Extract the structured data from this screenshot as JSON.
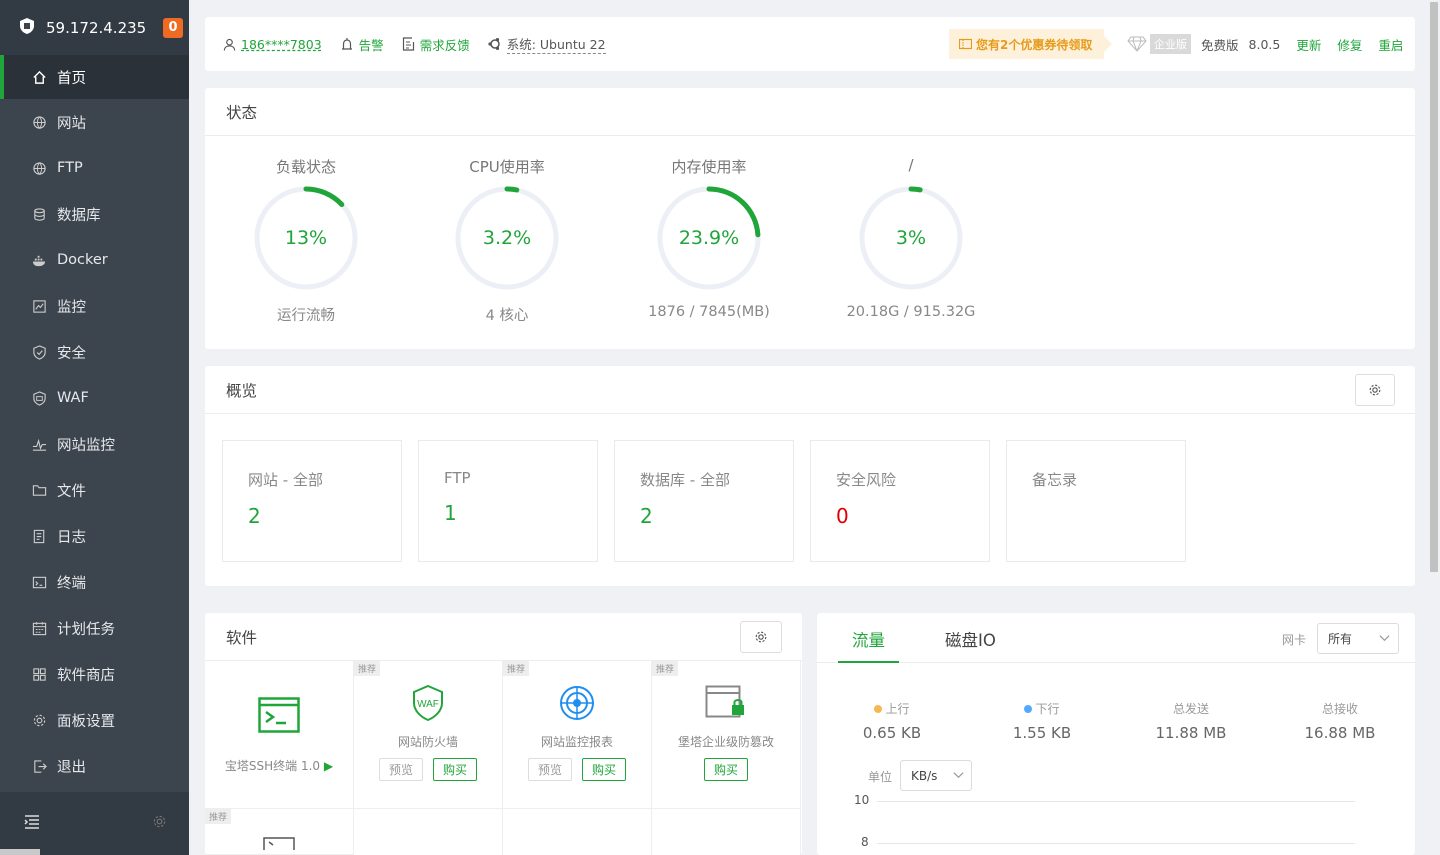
{
  "sidebar": {
    "server_ip": "59.172.4.235",
    "badge_count": "0",
    "items": [
      {
        "label": "首页",
        "icon": "home-icon"
      },
      {
        "label": "网站",
        "icon": "globe-icon"
      },
      {
        "label": "FTP",
        "icon": "globe-icon"
      },
      {
        "label": "数据库",
        "icon": "database-icon"
      },
      {
        "label": "Docker",
        "icon": "docker-icon"
      },
      {
        "label": "监控",
        "icon": "monitor-icon"
      },
      {
        "label": "安全",
        "icon": "shield-icon"
      },
      {
        "label": "WAF",
        "icon": "waf-icon"
      },
      {
        "label": "网站监控",
        "icon": "pulse-icon"
      },
      {
        "label": "文件",
        "icon": "folder-icon"
      },
      {
        "label": "日志",
        "icon": "log-icon"
      },
      {
        "label": "终端",
        "icon": "terminal-icon"
      },
      {
        "label": "计划任务",
        "icon": "calendar-icon"
      },
      {
        "label": "软件商店",
        "icon": "grid-icon"
      },
      {
        "label": "面板设置",
        "icon": "gear-icon"
      },
      {
        "label": "退出",
        "icon": "logout-icon"
      }
    ]
  },
  "topbar": {
    "user": "186****7803",
    "alarm": "告警",
    "feedback": "需求反馈",
    "system": "系统:  Ubuntu 22",
    "coupon": "您有2个优惠券待领取",
    "enterprise_tag": "企业版",
    "edition": "免费版",
    "version": "8.0.5",
    "update": "更新",
    "repair": "修复",
    "restart": "重启"
  },
  "status": {
    "title": "状态",
    "gauges": [
      {
        "label": "负载状态",
        "value": "13%",
        "pct": 13,
        "sub": "运行流畅"
      },
      {
        "label": "CPU使用率",
        "value": "3.2%",
        "pct": 3.2,
        "sub": "4 核心"
      },
      {
        "label": "内存使用率",
        "value": "23.9%",
        "pct": 23.9,
        "sub": "1876 / 7845(MB)"
      },
      {
        "label": "/",
        "value": "3%",
        "pct": 3,
        "sub": "20.18G / 915.32G"
      }
    ]
  },
  "overview": {
    "title": "概览",
    "boxes": [
      {
        "label": "网站 - 全部",
        "value": "2"
      },
      {
        "label": "FTP",
        "value": "1"
      },
      {
        "label": "数据库 - 全部",
        "value": "2"
      },
      {
        "label": "安全风险",
        "value": "0"
      },
      {
        "label": "备忘录",
        "value": ""
      }
    ]
  },
  "software": {
    "title": "软件",
    "recommend_tag": "推荐",
    "items": [
      {
        "name": "宝塔SSH终端 1.0"
      },
      {
        "name": "网站防火墙",
        "preview": "预览",
        "buy": "购买"
      },
      {
        "name": "网站监控报表",
        "preview": "预览",
        "buy": "购买"
      },
      {
        "name": "堡塔企业级防篡改",
        "buy": "购买"
      }
    ]
  },
  "traffic": {
    "tab_traffic": "流量",
    "tab_disk": "磁盘IO",
    "nic_label": "网卡",
    "nic_value": "所有",
    "stats": [
      {
        "label": "上行",
        "value": "0.65 KB",
        "color": "#f7b851"
      },
      {
        "label": "下行",
        "value": "1.55 KB",
        "color": "#52a9ff"
      },
      {
        "label": "总发送",
        "value": "11.88 MB"
      },
      {
        "label": "总接收",
        "value": "16.88 MB"
      }
    ],
    "unit_label": "单位",
    "unit_value": "KB/s",
    "y_ticks": [
      "10",
      "8"
    ]
  },
  "colors": {
    "accent": "#20a53a",
    "danger": "#e00000",
    "sidebar": "#3c444d"
  }
}
